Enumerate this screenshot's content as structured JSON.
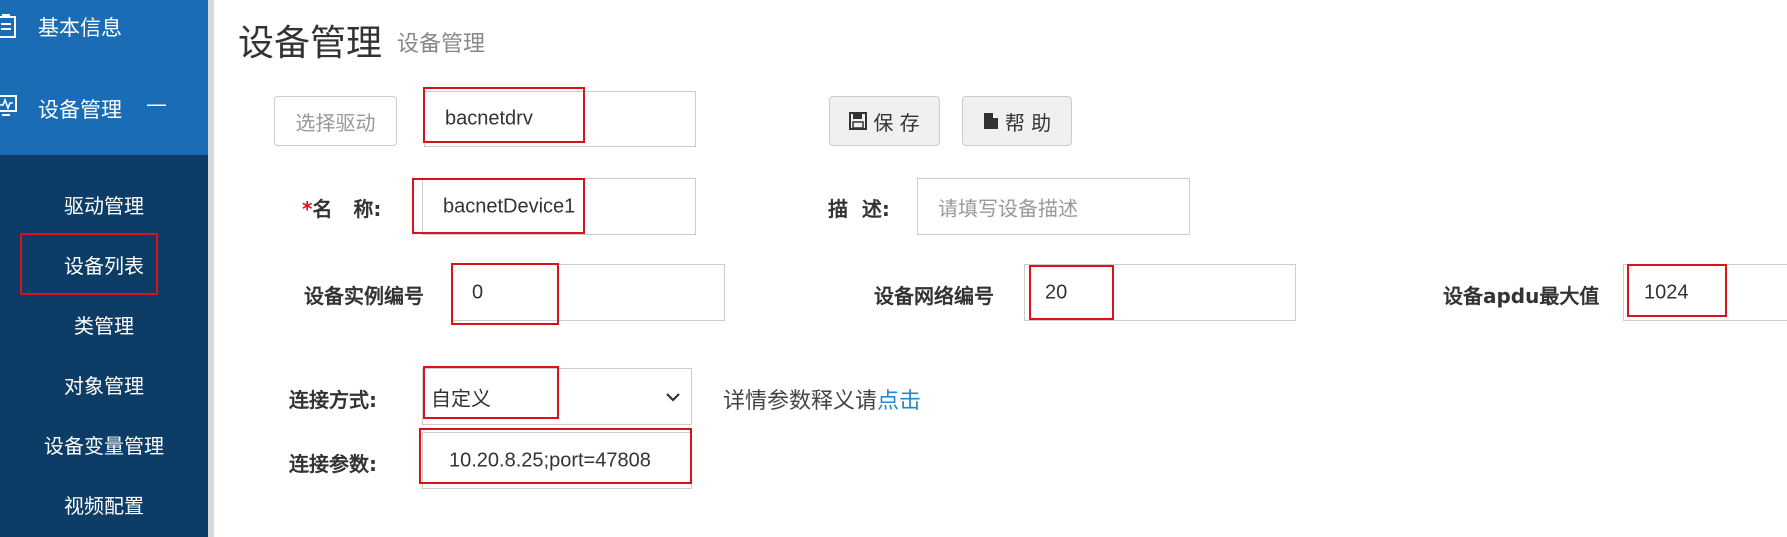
{
  "sidebar": {
    "top_items": [
      {
        "label": "基本信息",
        "icon": "clipboard-icon"
      },
      {
        "label": "设备管理",
        "icon": "monitor-icon",
        "collapse": "—"
      }
    ],
    "sub_items": [
      {
        "label": "驱动管理"
      },
      {
        "label": "设备列表",
        "selected": true
      },
      {
        "label": "类管理"
      },
      {
        "label": "对象管理"
      },
      {
        "label": "设备变量管理"
      },
      {
        "label": "视频配置"
      }
    ]
  },
  "header": {
    "title": "设备管理",
    "subtitle": "设备管理"
  },
  "form": {
    "driver_select_button": "选择驱动",
    "driver_value": "bacnetdrv",
    "save_button": "保 存",
    "help_button": "帮 助",
    "name_star": "*",
    "name_label": "名   称:",
    "name_value": "bacnetDevice1",
    "desc_label": "描  述:",
    "desc_placeholder": "请填写设备描述",
    "instance_label": "设备实例编号",
    "instance_value": "0",
    "network_label": "设备网络编号",
    "network_value": "20",
    "apdu_label": "设备apdu最大值",
    "apdu_value": "1024",
    "conn_type_label": "连接方式:",
    "conn_type_value": "自定义",
    "detail_text": "详情参数释义请",
    "detail_link": "点击",
    "conn_param_label": "连接参数:",
    "conn_param_value": "10.20.8.25;port=47808"
  },
  "colors": {
    "sidebar_dark": "#0d3d66",
    "sidebar_active": "#1a6db5",
    "highlight": "#d9121c",
    "link": "#2a87c8"
  }
}
